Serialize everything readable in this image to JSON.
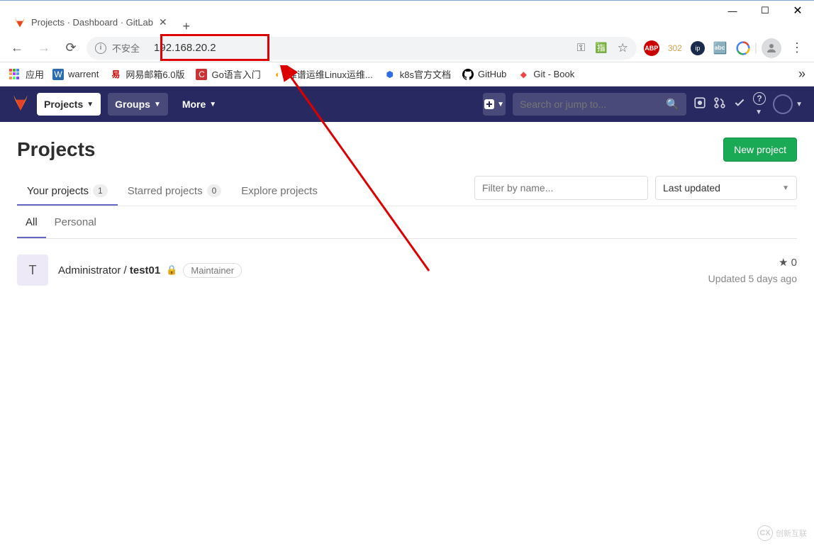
{
  "window": {
    "tab_title": "Projects · Dashboard · GitLab"
  },
  "toolbar": {
    "security_label": "不安全",
    "url": "192.168.20.2",
    "ext_count": "302"
  },
  "bookmarks": {
    "apps": "应用",
    "items": [
      "warrent",
      "网易邮箱6.0版",
      "Go语言入门",
      "靠谱运维Linux运维...",
      "k8s官方文档",
      "GitHub",
      "Git - Book"
    ]
  },
  "nav": {
    "projects": "Projects",
    "groups": "Groups",
    "more": "More",
    "search_placeholder": "Search or jump to..."
  },
  "page": {
    "title": "Projects",
    "new_button": "New project",
    "tabs": [
      {
        "label": "Your projects",
        "count": "1"
      },
      {
        "label": "Starred projects",
        "count": "0"
      },
      {
        "label": "Explore projects"
      }
    ],
    "filter_placeholder": "Filter by name...",
    "sort_label": "Last updated",
    "subtabs": [
      "All",
      "Personal"
    ],
    "project": {
      "avatar_letter": "T",
      "owner": "Administrator",
      "name": "test01",
      "role": "Maintainer",
      "stars": "0",
      "updated": "Updated 5 days ago"
    }
  },
  "watermark": "创新互联"
}
